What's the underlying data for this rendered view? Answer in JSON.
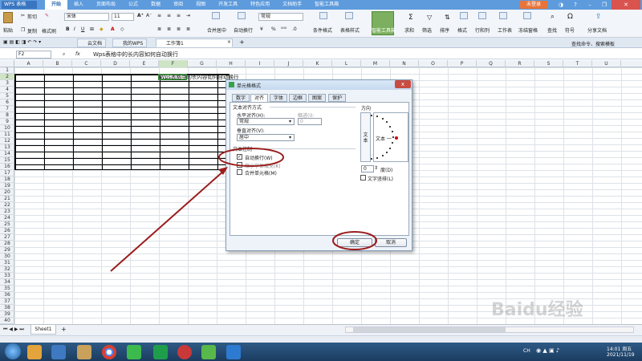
{
  "titlebar": {
    "app_name": "WPS 表格",
    "menu": [
      "开始",
      "插入",
      "页面布局",
      "公式",
      "数据",
      "审阅",
      "视图",
      "开发工具",
      "特色应用",
      "文档助手",
      "智能工具箱"
    ],
    "login": "未登录"
  },
  "ribbon": {
    "cut": "剪切",
    "paste": "粘贴",
    "copy": "复制",
    "format_painter": "格式刷",
    "font_name": "宋体",
    "font_size": "11",
    "number_format": "常规",
    "merge_center": "合并居中",
    "auto_wrap": "自动换行",
    "cond_format": "条件格式",
    "table_style": "表格样式",
    "smart_toolbox": "智能工具箱",
    "sum": "求和",
    "filter": "筛选",
    "sort": "排序",
    "format": "格式",
    "rows_cols": "行和列",
    "worksheet": "工作表",
    "freeze": "冻结窗格",
    "find": "查找",
    "symbol": "符号",
    "share": "分享文档"
  },
  "doctabs": {
    "cloud": "云文档",
    "mywps": "我的WPS",
    "workbook": "工作簿1",
    "search": "查找命令、搜索模板"
  },
  "formula_bar": {
    "cell_ref": "F2",
    "fx": "fx",
    "content": "Wps表格中的长内容如何自动换行"
  },
  "columns": [
    "A",
    "B",
    "C",
    "D",
    "E",
    "F",
    "G",
    "H",
    "I",
    "J",
    "K",
    "L",
    "M",
    "N",
    "O",
    "P",
    "Q",
    "R",
    "S",
    "T",
    "U"
  ],
  "rows": [
    "1",
    "2",
    "3",
    "4",
    "5",
    "6",
    "7",
    "8",
    "9",
    "10",
    "11",
    "12",
    "13",
    "14",
    "15",
    "16",
    "17",
    "18",
    "19",
    "20",
    "21",
    "22",
    "23",
    "24",
    "25",
    "26",
    "27",
    "28",
    "29",
    "30",
    "31",
    "32",
    "33",
    "34",
    "35",
    "36",
    "37",
    "38",
    "39",
    "40"
  ],
  "cell_f2": "Wps表格中的长内容如何自动换行",
  "sheet": {
    "tab": "Sheet1",
    "add": "+"
  },
  "dialog": {
    "title": "单元格格式",
    "close": "x",
    "tabs": [
      "数字",
      "对齐",
      "字体",
      "边框",
      "图案",
      "保护"
    ],
    "text_align_group": "文本对齐方式",
    "horizontal_label": "水平对齐(H):",
    "horizontal_value": "常规",
    "indent_label": "缩进(I):",
    "indent_value": "0",
    "vertical_label": "垂直对齐(V):",
    "vertical_value": "居中",
    "text_control_group": "文本控制",
    "wrap_text": "自动换行(W)",
    "wrap_checked": true,
    "shrink_fit": "缩小字体填充(K)",
    "merge_cells": "合并单元格(M)",
    "orientation_group": "方向",
    "vertical_text": "文本",
    "dial_text": "文本 一",
    "degree_value": "0",
    "degree_label": "度(D)",
    "text_vertical": "文字竖排(L)",
    "ok": "确定",
    "cancel": "取消"
  },
  "taskbar": {
    "lang": "CH",
    "time": "14:01 周五",
    "date": "2021/11/19"
  },
  "watermark": "Baidu经验",
  "colors": {
    "title_blue": "#5d9bdd",
    "annotation_red": "#9b1c1c",
    "cell_select_green": "#3d8a3d"
  }
}
